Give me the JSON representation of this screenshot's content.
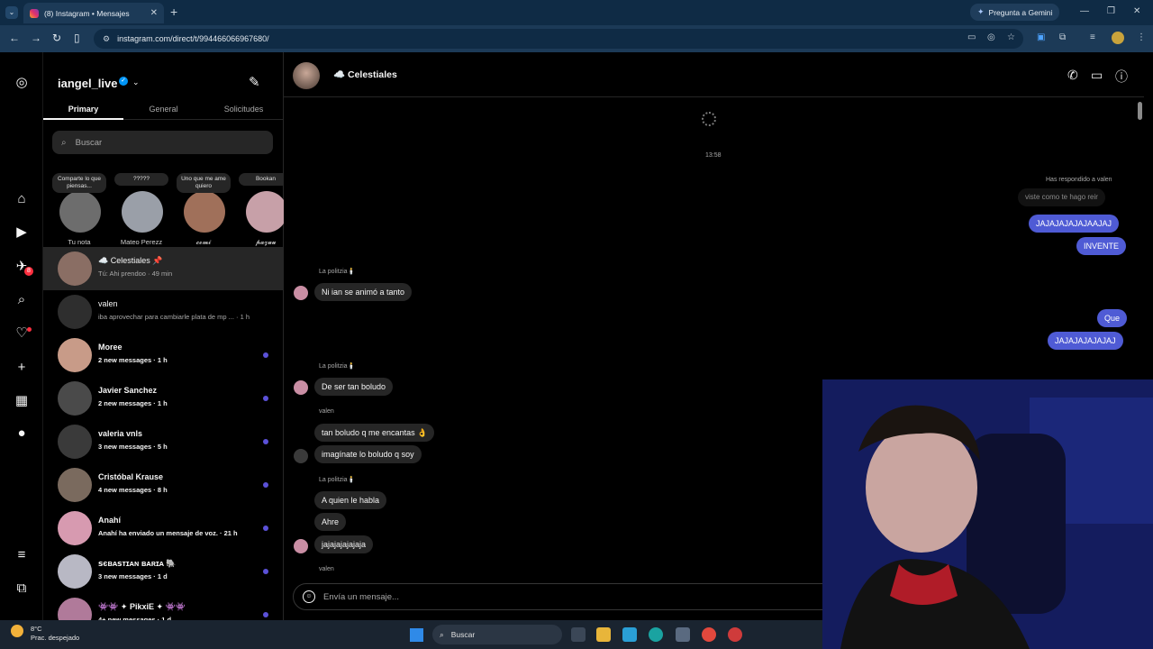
{
  "browser": {
    "tab_title": "(8) Instagram • Mensajes",
    "new_tab": "+",
    "gemini_label": "Pregunta a Gemini",
    "url": "instagram.com/direct/t/994466066967680/"
  },
  "header": {
    "username": "iangel_live",
    "verified": "✓"
  },
  "tabs": [
    "Primary",
    "General",
    "Solicitudes"
  ],
  "search": {
    "placeholder": "Buscar"
  },
  "notes": [
    {
      "bubble": "Comparte lo que piensas...",
      "name": "Tu nota",
      "color": "#6d6d6d"
    },
    {
      "bubble": "?????",
      "name": "Mateo Perezz",
      "color": "#9a9fa8"
    },
    {
      "bubble": "Uno que me ame quiero",
      "name": "𝓬𝓸𝓶𝓲",
      "color": "#a0705a"
    },
    {
      "bubble": "Bookan",
      "name": "𝓹𝓪𝔃𝓾𝓾",
      "color": "#c7a0a8"
    }
  ],
  "conversations": [
    {
      "name": "☁️ Celestiales 📌",
      "sub": "Tú: Ahi prendoo · 49 min",
      "unread": false,
      "active": true,
      "color": "#8a6e64"
    },
    {
      "name": "valen",
      "sub": "iba aprovechar para cambiarle plata de mp ... · 1 h",
      "unread": false,
      "active": false,
      "color": "#2e2e2e"
    },
    {
      "name": "Moree",
      "sub": "2 new messages · 1 h",
      "unread": true,
      "active": false,
      "color": "#c89b88"
    },
    {
      "name": "Javier Sanchez",
      "sub": "2 new messages · 1 h",
      "unread": true,
      "active": false,
      "color": "#4a4a4a"
    },
    {
      "name": "valeria vnls",
      "sub": "3 new messages · 5 h",
      "unread": true,
      "active": false,
      "color": "#3a3a3a"
    },
    {
      "name": "Cristóbal Krause",
      "sub": "4 new messages · 8 h",
      "unread": true,
      "active": false,
      "color": "#7a6a5e"
    },
    {
      "name": "Anahí",
      "sub": "Anahí ha enviado un mensaje de voz. · 21 h",
      "unread": true,
      "active": false,
      "color": "#d79ab0"
    },
    {
      "name": "ꜱєʙᴀꜱᴛɪᴀɴ ʙᴀʀɪᴀ 🐘",
      "sub": "3 new messages · 1 d",
      "unread": true,
      "active": false,
      "color": "#b8b8c4"
    },
    {
      "name": "👾👾 ✦ PikxiE ✦ 👾👾",
      "sub": "4+ new messages · 1 d",
      "unread": true,
      "active": false,
      "color": "#b07a9a"
    }
  ],
  "chat": {
    "title": "☁️ Celestiales",
    "timestamp": "13:58",
    "reply_label": "Has respondido a valen",
    "reply_quote": "viste como te hago reir",
    "messages": {
      "m1": "JAJAJAJAJAJAAJAJ",
      "m2": "INVENTE",
      "s1": "La politzia🕯️",
      "m3": "Ni ian se animó a tanto",
      "m4": "Que",
      "m5": "JAJAJAJAJAJAJ",
      "s2": "La politzia🕯️",
      "m6": "De ser tan boludo",
      "s3": "valen",
      "m7": "tan boludo q me encantas 👌",
      "m8": "imagínate lo boludo q soy",
      "s4": "La politzia🕯️",
      "m9": "A quien le habla",
      "m10": "Ahre",
      "m11": "jajajajajajaja",
      "s5": "valen"
    },
    "input_placeholder": "Envía un mensaje..."
  },
  "left_nav": {
    "messages_badge": "8"
  },
  "taskbar": {
    "temp": "8°C",
    "weather": "Prac. despejado",
    "search": "Buscar"
  }
}
